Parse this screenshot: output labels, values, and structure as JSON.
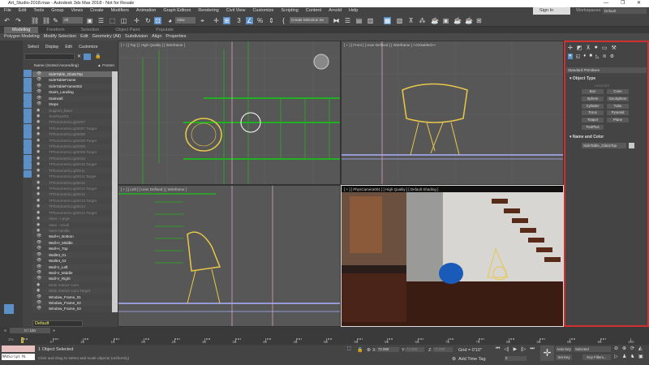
{
  "title": "Art_Studio-2018.max - Autodesk 3ds Max 2018 - Not for Resale",
  "window_controls": [
    "—",
    "❐",
    "✕"
  ],
  "menu": [
    "File",
    "Edit",
    "Tools",
    "Group",
    "Views",
    "Create",
    "Modifiers",
    "Animation",
    "Graph Editors",
    "Rendering",
    "Civil View",
    "Customize",
    "Scripting",
    "Content",
    "Arnold",
    "Help"
  ],
  "toolbar": {
    "filter": "All",
    "ref_coord": "View",
    "selection_set": "Create Selection Se"
  },
  "signin": "Sign In",
  "workspaces_label": "Workspaces:",
  "workspace": "Default",
  "ribbon_tabs": [
    "Modeling",
    "Freeform",
    "Selection",
    "Object Paint",
    "Populate"
  ],
  "ribbon_items": [
    "Polygon Modeling",
    "Modify Selection",
    "Edit",
    "Geometry (All)",
    "Subdivision",
    "Align",
    "Properties"
  ],
  "explorer": {
    "menu": [
      "Select",
      "Display",
      "Edit",
      "Customize"
    ],
    "col_name": "Name (Sorted Ascending)",
    "col_frozen": "▲ Frozen",
    "items": [
      {
        "name": "SideTable_GlassTop",
        "state": "sel"
      },
      {
        "name": "SideTableFrame"
      },
      {
        "name": "SideTableFrame002"
      },
      {
        "name": "Stairs_Landing"
      },
      {
        "name": "Stairwall"
      },
      {
        "name": "Steps"
      },
      {
        "name": "Support_Base",
        "state": "dim"
      },
      {
        "name": "TextPlus001",
        "state": "dim"
      },
      {
        "name": "TPhotometricLight007",
        "state": "dim"
      },
      {
        "name": "TPhotometricLight007.Target",
        "state": "dim"
      },
      {
        "name": "TPhotometricLight008",
        "state": "dim"
      },
      {
        "name": "TPhotometricLight008.Target",
        "state": "dim"
      },
      {
        "name": "TPhotometricLight009",
        "state": "dim"
      },
      {
        "name": "TPhotometricLight009.Target",
        "state": "dim"
      },
      {
        "name": "TPhotometricLight010",
        "state": "dim"
      },
      {
        "name": "TPhotometricLight010.Target",
        "state": "dim"
      },
      {
        "name": "TPhotometricLight011",
        "state": "dim"
      },
      {
        "name": "TPhotometricLight011.Target",
        "state": "dim"
      },
      {
        "name": "TPhotometricLight012",
        "state": "dim"
      },
      {
        "name": "TPhotometricLight012.Target",
        "state": "dim"
      },
      {
        "name": "TPhotometricLight013",
        "state": "dim"
      },
      {
        "name": "TPhotometricLight013.Target",
        "state": "dim"
      },
      {
        "name": "TPhotometricLight014",
        "state": "dim"
      },
      {
        "name": "TPhotometricLight014.Target",
        "state": "dim"
      },
      {
        "name": "Vase - Large",
        "state": "dim"
      },
      {
        "name": "Vase - small",
        "state": "dim"
      },
      {
        "name": "Vase Handle",
        "state": "dim"
      },
      {
        "name": "Wall-H_Bottom"
      },
      {
        "name": "Wall-H_Middle"
      },
      {
        "name": "Wall-H_Top"
      },
      {
        "name": "WallInt_01"
      },
      {
        "name": "WallInt_02"
      },
      {
        "name": "Wall-V_Left"
      },
      {
        "name": "Wall-V_Middle"
      },
      {
        "name": "Wall-V_Right"
      },
      {
        "name": "Wide Interior Cam",
        "state": "dim"
      },
      {
        "name": "Wide Interior Cam.Target",
        "state": "dim"
      },
      {
        "name": "Window_Frame_01"
      },
      {
        "name": "Window_Frame_02"
      },
      {
        "name": "Window_Frame_03"
      }
    ],
    "layer": "Default"
  },
  "viewports": {
    "top": "[ + ] [ Top ] [ High Quality ] [ Wireframe ]",
    "front": "[ + ] [ Front ] [ User Defined ] [ Wireframe ]  <<Disabled>>",
    "left": "[ + ] [ Left ] [ User Defined ] [ Wireframe ]",
    "camera": "[ + ] [ PhysCamera001 ] [ High Quality ] [ Default Shading ]"
  },
  "command_panel": {
    "category": "Standard Primitives",
    "object_type": "Object Type",
    "autogrid": "AutoGrid",
    "buttons": [
      "Box",
      "Cone",
      "Sphere",
      "GeoSphere",
      "Cylinder",
      "Tube",
      "Torus",
      "Pyramid",
      "Teapot",
      "Plane",
      "TextPlus"
    ],
    "name_and_color": "Name and Color",
    "object_name": "SideTable_GlassTop",
    "object_color": "#c8c8c8"
  },
  "timeline": {
    "frame": "0 / 100",
    "ticks": [
      0,
      5,
      10,
      15,
      20,
      25,
      30,
      35,
      40,
      45,
      50,
      55,
      60,
      65,
      70,
      75,
      80,
      85,
      90,
      95,
      100
    ]
  },
  "status": {
    "maxscript": "MAXScript Mi",
    "selected": "1 Object Selected",
    "prompt": "Click and drag to select and scale objects (uniformly)",
    "x_label": "X:",
    "x": "72.088",
    "y_label": "Y:",
    "y": "72.088",
    "z_label": "Z:",
    "z": "72.088",
    "grid": "Grid = 0'10\"",
    "add_time_tag": "Add Time Tag",
    "current_frame": "0",
    "auto_key": "Auto Key",
    "set_key": "Set Key",
    "key_mode": "Selected",
    "key_filters": "Key Filters...",
    "zoom_pct": "1%"
  },
  "colors": {
    "accent": "#5b8fc7",
    "highlight": "#d23030",
    "wire_yellow": "#e8c84a",
    "grid_green": "#22b022"
  }
}
